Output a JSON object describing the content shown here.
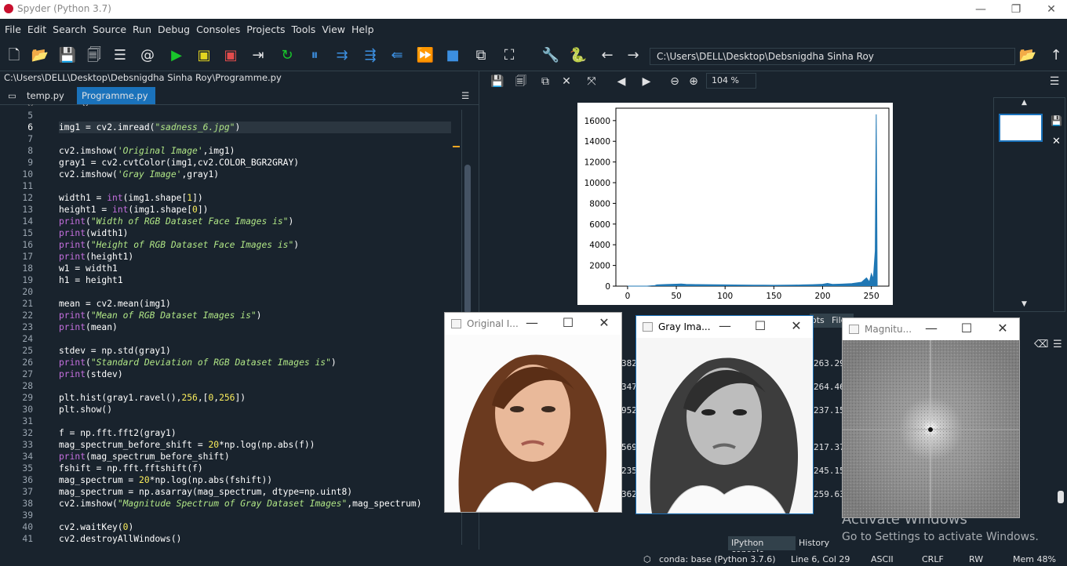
{
  "window": {
    "title": "Spyder (Python 3.7)",
    "min": "—",
    "max": "❐",
    "close": "✕"
  },
  "menu": [
    "File",
    "Edit",
    "Search",
    "Source",
    "Run",
    "Debug",
    "Consoles",
    "Projects",
    "Tools",
    "View",
    "Help"
  ],
  "toolbar": {
    "path": "C:\\Users\\DELL\\Desktop\\Debsnigdha Sinha Roy"
  },
  "editor": {
    "filepath": "C:\\Users\\DELL\\Desktop\\Debsnigdha Sinha Roy\\Programme.py",
    "tabs": [
      {
        "label": "temp.py"
      },
      {
        "label": "Programme.py"
      }
    ],
    "line_numbers": [
      "5",
      "6",
      "7",
      "8",
      "9",
      "10",
      "11",
      "12",
      "13",
      "14",
      "15",
      "16",
      "17",
      "18",
      "19",
      "20",
      "21",
      "22",
      "23",
      "24",
      "25",
      "26",
      "27",
      "28",
      "29",
      "30",
      "31",
      "32",
      "33",
      "34",
      "35",
      "36",
      "37",
      "38",
      "39",
      "40",
      "41"
    ],
    "lines": [
      "",
      "img1 = cv2.imread(\"sadness_6.jpg\")",
      "",
      "cv2.imshow('Original Image',img1)",
      "gray1 = cv2.cvtColor(img1,cv2.COLOR_BGR2GRAY)",
      "cv2.imshow('Gray Image',gray1)",
      "",
      "width1 = int(img1.shape[1])",
      "height1 = int(img1.shape[0])",
      "print(\"Width of RGB Dataset Face Images is\")",
      "print(width1)",
      "print(\"Height of RGB Dataset Face Images is\")",
      "print(height1)",
      "w1 = width1",
      "h1 = height1",
      "",
      "mean = cv2.mean(img1)",
      "print(\"Mean of RGB Dataset Images is\")",
      "print(mean)",
      "",
      "stdev = np.std(gray1)",
      "print(\"Standard Deviation of RGB Dataset Images is\")",
      "print(stdev)",
      "",
      "plt.hist(gray1.ravel(),256,[0,256])",
      "plt.show()",
      "",
      "f = np.fft.fft2(gray1)",
      "mag_spectrum_before_shift = 20*np.log(np.abs(f))",
      "print(mag_spectrum_before_shift)",
      "fshift = np.fft.fftshift(f)",
      "mag_spectrum = 20*np.log(np.abs(fshift))",
      "mag_spectrum = np.asarray(mag_spectrum, dtype=np.uint8)",
      "cv2.imshow(\"Magnitude Spectrum of Gray Dataset Images\",mag_spectrum)",
      "",
      "cv2.waitKey(0)",
      "cv2.destroyAllWindows()"
    ]
  },
  "plots": {
    "zoom": "104 %",
    "pane_tabs": [
      "ots",
      "File"
    ]
  },
  "chart_data": {
    "type": "bar",
    "title": "",
    "xlabel": "",
    "ylabel": "",
    "xlim": [
      -12,
      268
    ],
    "ylim": [
      0,
      17200
    ],
    "xticks": [
      "0",
      "50",
      "100",
      "150",
      "200",
      "250"
    ],
    "yticks": [
      "0",
      "2000",
      "4000",
      "6000",
      "8000",
      "10000",
      "12000",
      "14000",
      "16000"
    ],
    "bins_x": [
      0,
      20,
      25,
      28,
      30,
      40,
      50,
      55,
      60,
      70,
      80,
      90,
      100,
      110,
      120,
      130,
      140,
      150,
      160,
      170,
      180,
      190,
      200,
      205,
      210,
      220,
      230,
      240,
      245,
      248,
      250,
      252,
      254,
      255,
      256
    ],
    "bins_y": [
      0,
      0,
      40,
      60,
      120,
      160,
      190,
      210,
      170,
      150,
      140,
      130,
      120,
      110,
      100,
      95,
      90,
      85,
      90,
      100,
      120,
      140,
      180,
      260,
      170,
      200,
      250,
      380,
      800,
      400,
      1200,
      700,
      3400,
      16600,
      0
    ]
  },
  "windows": {
    "original": {
      "title": "Original I..."
    },
    "gray": {
      "title": "Gray Ima..."
    },
    "magnitude": {
      "title": "Magnitu..."
    }
  },
  "console": {
    "left_vals": [
      "382",
      "347",
      "952",
      "569",
      "235",
      "362"
    ],
    "right_vals": [
      "263.29",
      "264.46",
      "237.15",
      "217.37",
      "245.15",
      "259.63"
    ],
    "tabs": [
      "IPython console",
      "History"
    ]
  },
  "watermark": {
    "line1": "Activate Windows",
    "line2": "Go to Settings to activate Windows."
  },
  "status": {
    "env": "conda: base (Python 3.7.6)",
    "pos": "Line 6, Col 29",
    "enc": "ASCII",
    "eol": "CRLF",
    "perm": "RW",
    "mem": "Mem 48%"
  }
}
